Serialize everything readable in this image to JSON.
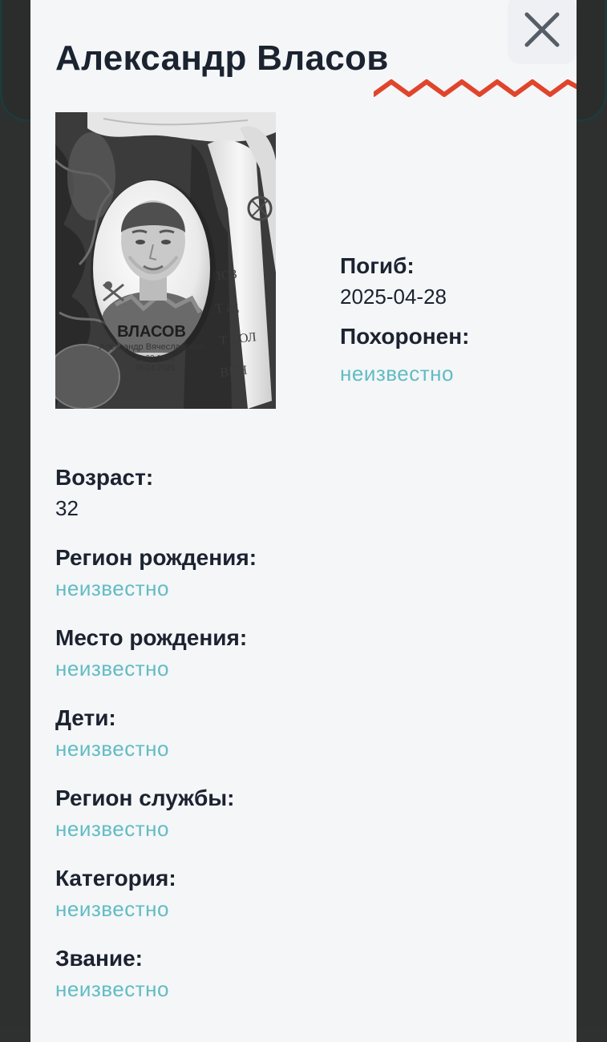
{
  "person": {
    "name": "Александр Власов"
  },
  "photo": {
    "plaque_surname": "ВЛАСОВ",
    "plaque_fullname": "Александр Вячеславович",
    "plaque_birth": "11.03.1993",
    "plaque_death": "28.04.2025"
  },
  "death_info": {
    "died_label": "Погиб:",
    "died_value": "2025-04-28",
    "buried_label": "Похоронен:",
    "buried_value": "неизвестно"
  },
  "details": [
    {
      "label": "Возраст:",
      "value": "32",
      "known": true
    },
    {
      "label": "Регион рождения:",
      "value": "неизвестно",
      "known": false
    },
    {
      "label": "Место рождения:",
      "value": "неизвестно",
      "known": false
    },
    {
      "label": "Дети:",
      "value": "неизвестно",
      "known": false
    },
    {
      "label": "Регион службы:",
      "value": "неизвестно",
      "known": false
    },
    {
      "label": "Категория:",
      "value": "неизвестно",
      "known": false
    },
    {
      "label": "Звание:",
      "value": "неизвестно",
      "known": false
    }
  ],
  "colors": {
    "accent_zigzag": "#e0452b",
    "unknown_text": "#62bcc3",
    "heading_text": "#1b2330",
    "modal_bg": "#f4f6f8"
  },
  "icons": {
    "close": "close-icon"
  }
}
